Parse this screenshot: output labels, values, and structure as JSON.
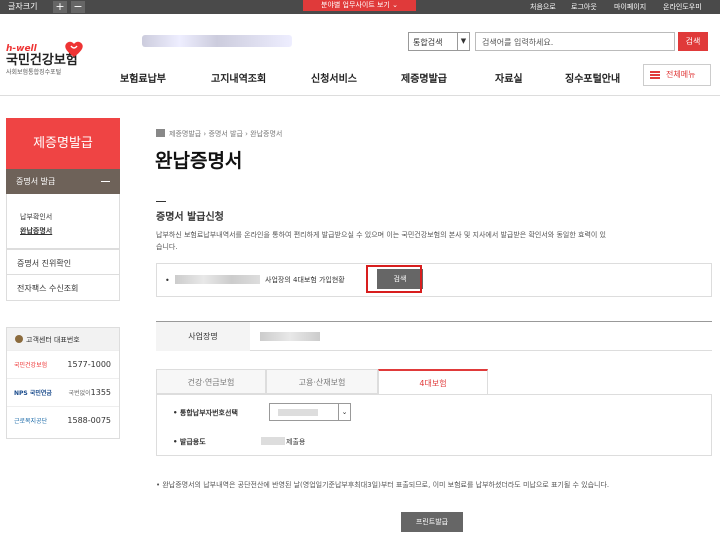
{
  "topbar": {
    "font_size_label": "글자크기",
    "plus": "+",
    "minus": "−",
    "biz_site_label": "분야별 업무사이트 보기",
    "utility": [
      "처음으로",
      "로그아웃",
      "마이페이지",
      "온라인도우미"
    ]
  },
  "logo": {
    "en": "h-well",
    "ko": "국민건강보험",
    "sub": "사회보험통합징수포털"
  },
  "search": {
    "select_value": "통합검색",
    "placeholder": "검색어를 입력하세요.",
    "button": "검색"
  },
  "gnb": [
    "보험료납부",
    "고지내역조회",
    "신청서비스",
    "제증명발급",
    "자료실",
    "징수포털안내"
  ],
  "all_menu": "전체메뉴",
  "sidebar": {
    "title": "제증명발급",
    "category": "증명서 발급",
    "sub_items": [
      "납부확인서",
      "완납증명서"
    ],
    "items": [
      "증명서 진위확인",
      "전자팩스 수신조회"
    ],
    "call_center": {
      "title": "고객센터 대표번호",
      "rows": [
        {
          "org": "국민건강보험",
          "label": "",
          "number": "1577-1000"
        },
        {
          "org": "NPS 국민연금",
          "label": "국번없이",
          "number": "1355"
        },
        {
          "org": "근로복지공단",
          "label": "",
          "number": "1588-0075"
        }
      ]
    }
  },
  "breadcrumb": [
    "제증명발급",
    "증명서 발급",
    "완납증명서"
  ],
  "page_title": "완납증명서",
  "section_title": "증명서 발급신청",
  "description": "납부하신 보험료납부내역서를 온라인을 통하여 편리하게 발급받으실 수 있으며 이는 국민건강보험의 본사 및 지사에서 발급받은 확인서와 동일한 효력이 있습니다.",
  "search_box": {
    "label": "사업장의 4대보험 가입현황",
    "button": "검색"
  },
  "biz_name_label": "사업장명",
  "tabs": [
    "건강·연금보험",
    "고용·산재보험",
    "4대보험"
  ],
  "form": {
    "payer_label": "통합납부자번호선택",
    "purpose_label": "발급용도",
    "purpose_value": "제출용"
  },
  "note": "완납증명서의 납부내역은 공단전산에 반영된 날(영업일기준납부후최대3일)부터 표출되므로, 이미 보험료를 납부하셨더라도 미납으로 표기될 수 있습니다.",
  "print_button": "프린트발급",
  "colors": {
    "accent": "#e03a3a",
    "highlight_frame": "#d81e1e",
    "side_category": "#6e6259"
  }
}
